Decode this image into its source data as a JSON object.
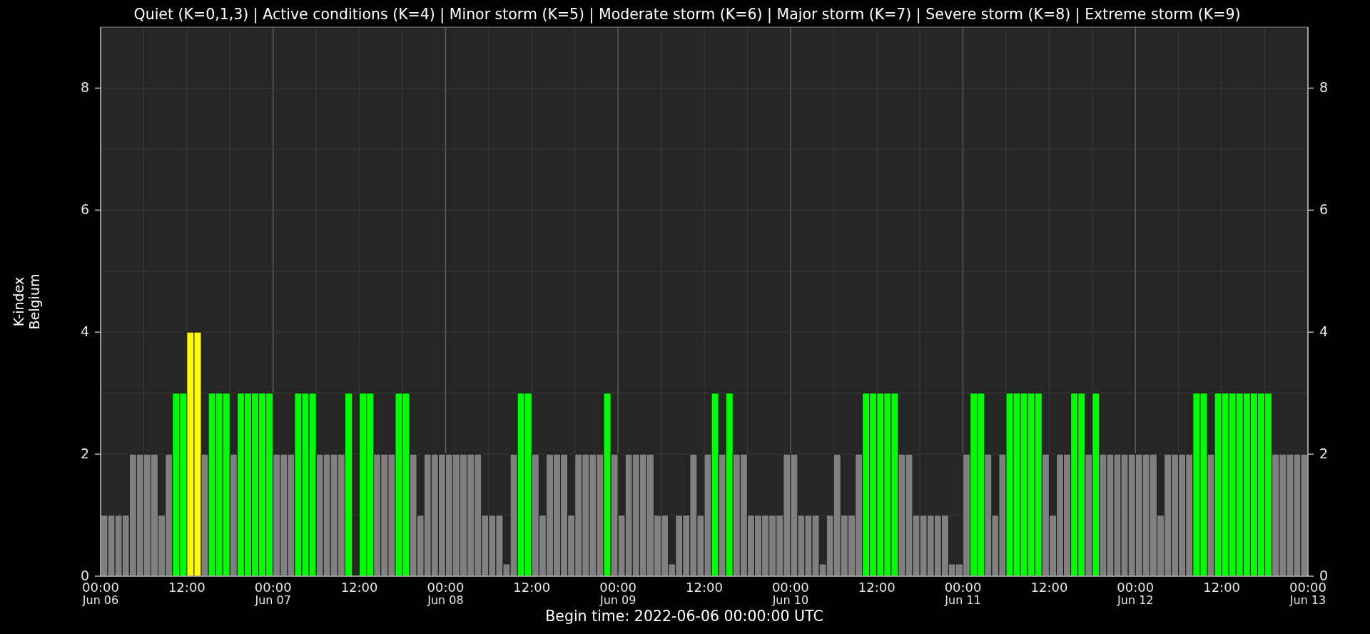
{
  "chart": {
    "chart_data": {
      "type": "bar",
      "title": "Quiet (K=0,1,3) | Active conditions (K=4) | Minor storm (K=5) | Moderate storm (K=6) | Major storm (K=7) | Severe storm (K=8) | Extreme storm (K=9)",
      "xlabel": "Begin time: 2022-06-06 00:00:00 UTC",
      "ylabel": "K-index\nBelgium",
      "ylim": [
        0,
        9
      ],
      "y2lim": [
        0,
        9
      ],
      "grid": true,
      "categories": [
        "00:00\nJun 06",
        null,
        null,
        null,
        null,
        null,
        null,
        null,
        null,
        null,
        null,
        null,
        "12:00",
        null,
        null,
        null,
        null,
        null,
        null,
        null,
        null,
        null,
        null,
        null,
        "00:00\nJun 07",
        null,
        null,
        null,
        null,
        null,
        null,
        null,
        null,
        null,
        null,
        null,
        "12:00",
        null,
        null,
        null,
        null,
        null,
        null,
        null,
        null,
        null,
        null,
        null,
        "00:00\nJun 08",
        null,
        null,
        null,
        null,
        null,
        null,
        null,
        null,
        null,
        null,
        null,
        "12:00",
        null,
        null,
        null,
        null,
        null,
        null,
        null,
        null,
        null,
        null,
        null,
        "00:00\nJun 09",
        null,
        null,
        null,
        null,
        null,
        null,
        null,
        null,
        null,
        null,
        null,
        "12:00",
        null,
        null,
        null,
        null,
        null,
        null,
        null,
        null,
        null,
        null,
        null,
        "00:00\nJun 10",
        null,
        null,
        null,
        null,
        null,
        null,
        null,
        null,
        null,
        null,
        null,
        "12:00",
        null,
        null,
        null,
        null,
        null,
        null,
        null,
        null,
        null,
        null,
        null,
        "00:00\nJun 11",
        null,
        null,
        null,
        null,
        null,
        null,
        null,
        null,
        null,
        null,
        null,
        "12:00",
        null,
        null,
        null,
        null,
        null,
        null,
        null,
        null,
        null,
        null,
        null,
        "00:00\nJun 12",
        null,
        null,
        null,
        null,
        null,
        null,
        null,
        null,
        null,
        null,
        null,
        "12:00",
        null,
        null,
        null,
        null,
        null,
        null,
        null,
        null,
        null,
        null,
        null
      ],
      "annotations": [
        "00:00\nJun 13"
      ],
      "values": [
        1,
        1,
        1,
        1,
        2,
        2,
        2,
        2,
        1,
        2,
        3,
        3,
        4,
        4,
        2,
        3,
        3,
        3,
        2,
        3,
        3,
        3,
        3,
        3,
        2,
        2,
        2,
        3,
        3,
        3,
        2,
        2,
        2,
        2,
        3,
        null,
        3,
        3,
        2,
        2,
        2,
        3,
        3,
        2,
        1,
        2,
        2,
        2,
        2,
        2,
        2,
        2,
        2,
        1,
        1,
        1,
        0.2,
        2,
        3,
        3,
        2,
        1,
        2,
        2,
        2,
        1,
        2,
        2,
        2,
        2,
        3,
        2,
        1,
        2,
        2,
        2,
        2,
        1,
        1,
        0.2,
        1,
        1,
        2,
        1,
        2,
        3,
        2,
        3,
        2,
        2,
        1,
        1,
        1,
        1,
        1,
        2,
        2,
        1,
        1,
        1,
        0.2,
        1,
        2,
        1,
        1,
        2,
        3,
        3,
        3,
        3,
        3,
        2,
        2,
        1,
        1,
        1,
        1,
        1,
        0.2,
        0.2,
        2,
        3,
        3,
        2,
        1,
        2,
        3,
        3,
        3,
        3,
        3,
        2,
        1,
        2,
        2,
        3,
        3,
        2,
        3,
        2,
        2,
        2,
        2,
        2,
        2,
        2,
        2,
        1,
        2,
        2,
        2,
        2,
        3,
        3,
        2,
        3,
        3,
        3,
        3,
        3,
        3,
        3,
        3,
        2,
        2,
        2,
        2,
        2
      ],
      "yticks": [
        0,
        2,
        4,
        6,
        8
      ],
      "y2ticks": [
        0,
        2,
        4,
        6,
        8
      ]
    }
  }
}
